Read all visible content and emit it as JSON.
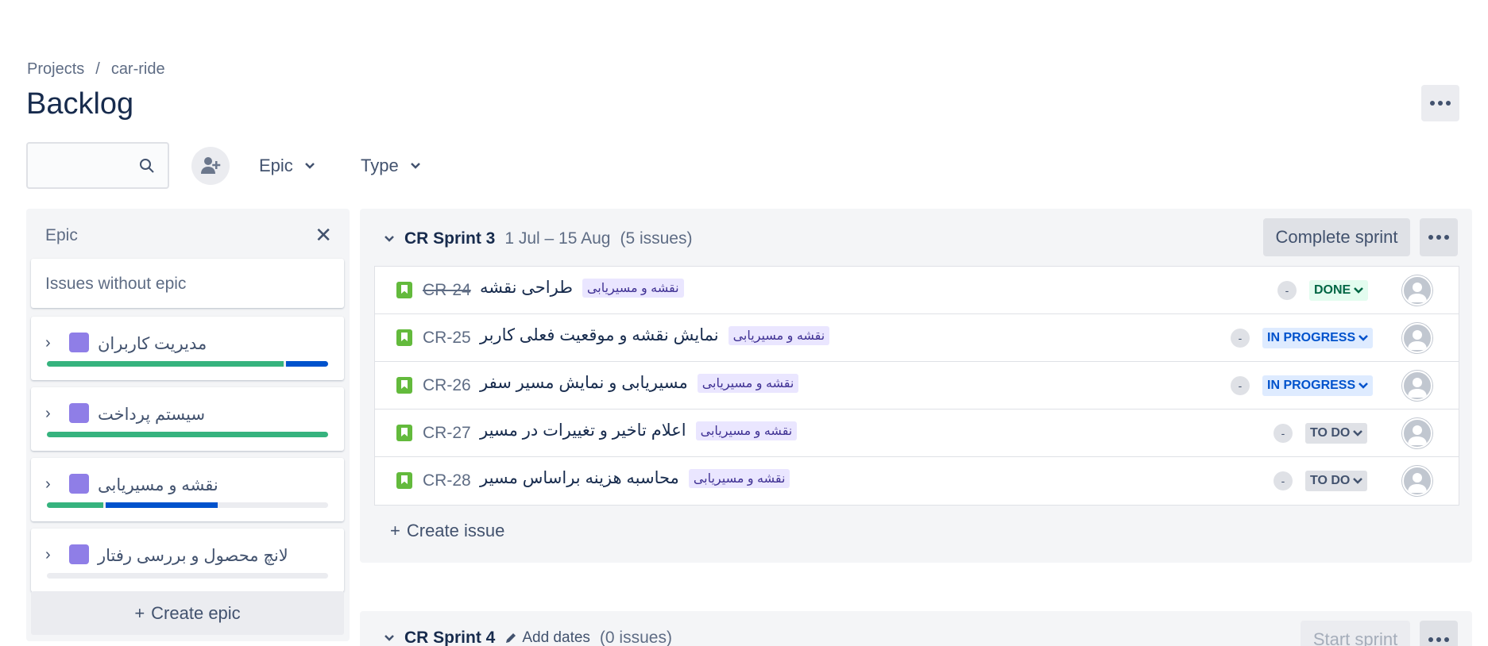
{
  "breadcrumb": {
    "projects": "Projects",
    "separator": "/",
    "project": "car-ride"
  },
  "page_title": "Backlog",
  "filters": {
    "epic": "Epic",
    "type": "Type"
  },
  "epic_panel": {
    "title": "Epic",
    "issues_without_epic": "Issues without epic",
    "create_epic": "Create epic",
    "epics": [
      {
        "name": "مدیریت کاربران",
        "done": 0.85,
        "in_progress": 0.15
      },
      {
        "name": "سیستم پرداخت",
        "done": 1.0,
        "in_progress": 0.0
      },
      {
        "name": "نقشه و مسیریابی",
        "done": 0.2,
        "in_progress": 0.4
      },
      {
        "name": "لانچ محصول و بررسی رفتار",
        "done": 0.0,
        "in_progress": 0.0
      }
    ],
    "colors": {
      "swatch": "#8f7ee7",
      "done": "#36b37e",
      "in_progress": "#0052cc"
    }
  },
  "sprint": {
    "name": "CR Sprint 3",
    "dates": "1 Jul – 15 Aug",
    "count": "(5 issues)",
    "complete_label": "Complete sprint",
    "create_issue": "Create issue",
    "issues": [
      {
        "key": "CR-24",
        "summary": "طراحی نقشه",
        "epic": "نقشه و مسیریابی",
        "estimate": "-",
        "status": "DONE"
      },
      {
        "key": "CR-25",
        "summary": "نمایش نقشه و موقعیت فعلی کاربر",
        "epic": "نقشه و مسیریابی",
        "estimate": "-",
        "status": "IN PROGRESS"
      },
      {
        "key": "CR-26",
        "summary": "مسیریابی و نمایش مسیر سفر",
        "epic": "نقشه و مسیریابی",
        "estimate": "-",
        "status": "IN PROGRESS"
      },
      {
        "key": "CR-27",
        "summary": "اعلام تاخیر و تغییرات در مسیر",
        "epic": "نقشه و مسیریابی",
        "estimate": "-",
        "status": "TO DO"
      },
      {
        "key": "CR-28",
        "summary": "محاسبه هزینه براساس مسیر",
        "epic": "نقشه و مسیریابی",
        "estimate": "-",
        "status": "TO DO"
      }
    ]
  },
  "sprint2": {
    "name": "CR Sprint 4",
    "add_dates": "Add dates",
    "count": "(0 issues)",
    "start_label": "Start sprint"
  }
}
